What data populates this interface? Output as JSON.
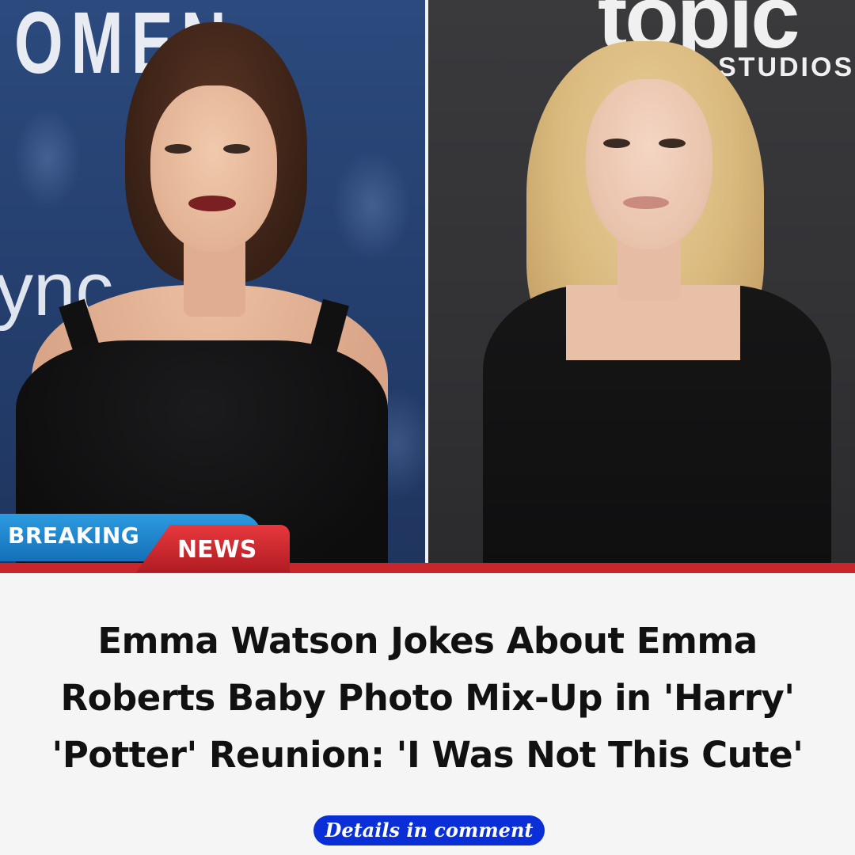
{
  "photos": {
    "left": {
      "background_text_top": "OMEN",
      "background_text_mid": "ync"
    },
    "right": {
      "background_text_top": "topic",
      "background_text_sub": "STUDIOS"
    }
  },
  "banner": {
    "breaking_label": "BREAKING",
    "news_label": "NEWS",
    "colors": {
      "breaking": "#1f86cf",
      "news": "#d52a30",
      "rule": "#c8262c"
    }
  },
  "headline": {
    "lines": [
      "Emma Watson Jokes About Emma",
      "Roberts Baby Photo Mix-Up in 'Harry'",
      "'Potter' Reunion: 'I Was Not This Cute'"
    ]
  },
  "cta": {
    "label": "Details in comment",
    "color": "#0b2fd6"
  }
}
